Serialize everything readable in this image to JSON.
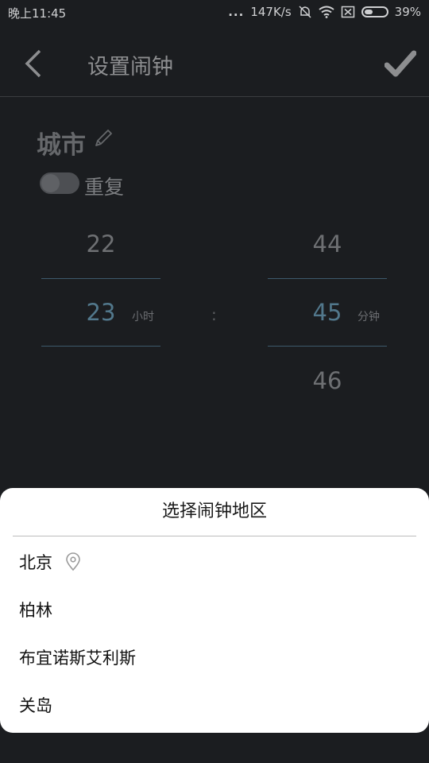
{
  "status_bar": {
    "time": "晚上11:45",
    "dots": "...",
    "network_speed": "147K/s",
    "battery_percent": "39%",
    "battery_level": 0.39
  },
  "header": {
    "title": "设置闹钟",
    "back_icon": "chevron-left-icon",
    "confirm_icon": "check-icon"
  },
  "alarm": {
    "city": "城市",
    "repeat_label": "重复",
    "repeat_on": false
  },
  "time_picker": {
    "hours": {
      "prev": "22",
      "current": "23",
      "next": "",
      "unit": "小时"
    },
    "separator": ":",
    "minutes": {
      "prev": "44",
      "current": "45",
      "next": "46",
      "unit": "分钟"
    }
  },
  "region_sheet": {
    "title": "选择闹钟地区",
    "items": [
      {
        "label": "北京",
        "icon": "location-pin-icon"
      },
      {
        "label": "柏林"
      },
      {
        "label": "布宜诺斯艾利斯"
      },
      {
        "label": "关岛"
      }
    ]
  },
  "colors": {
    "background": "#1b1d20",
    "picker_selected": "#52788c",
    "picker_line": "#3d5a6c",
    "sheet_background": "#ffffff"
  }
}
